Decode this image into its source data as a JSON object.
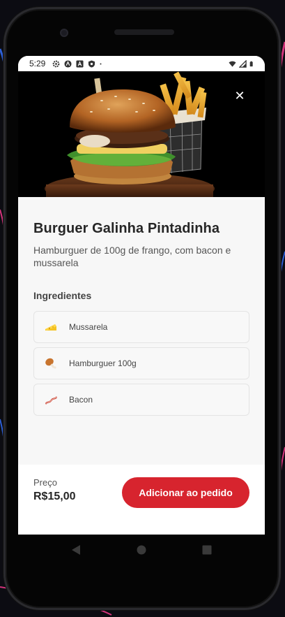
{
  "status_bar": {
    "time": "5:29",
    "left_icons": [
      "gear-icon",
      "android-icon",
      "font-a-icon",
      "shield-icon",
      "dot-icon"
    ],
    "right_icons": [
      "wifi-icon",
      "signal-icon",
      "battery-icon"
    ]
  },
  "product": {
    "title": "Burguer Galinha Pintadinha",
    "description": "Hamburguer de 100g de frango, com bacon e mussarela",
    "close_glyph": "✕"
  },
  "ingredients": {
    "heading": "Ingredientes",
    "items": [
      {
        "label": "Mussarela",
        "icon": "cheese-icon"
      },
      {
        "label": "Hamburguer 100g",
        "icon": "chicken-leg-icon"
      },
      {
        "label": "Bacon",
        "icon": "bacon-icon"
      }
    ]
  },
  "footer": {
    "price_label": "Preço",
    "price_value": "R$15,00",
    "add_button_label": "Adicionar ao pedido"
  },
  "colors": {
    "accent": "#d7242e",
    "background": "#f7f7f7",
    "text_dark": "#262626"
  },
  "nav": {
    "icons": [
      "back-icon",
      "home-icon",
      "recents-icon"
    ]
  }
}
